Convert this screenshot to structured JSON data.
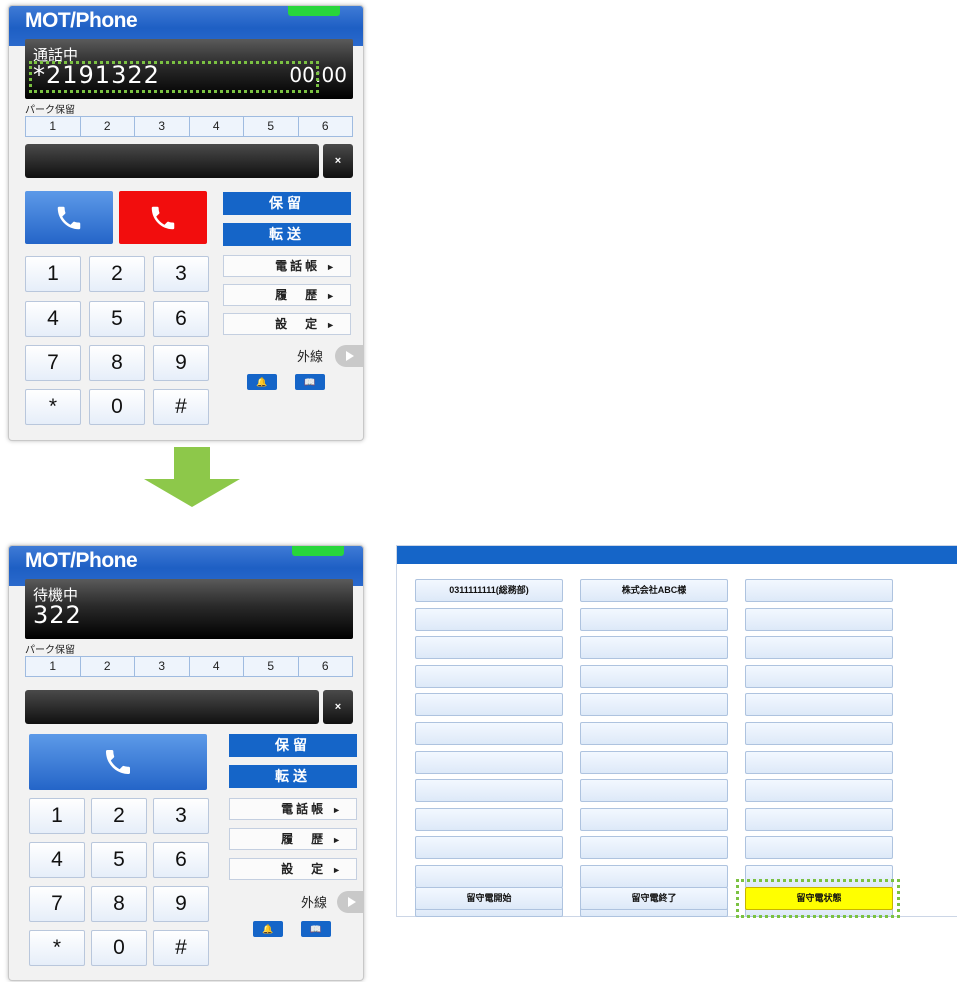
{
  "phone_top": {
    "logo": "MOT/Phone",
    "status": "通話中",
    "number": "*2191322",
    "timer": "00:00",
    "park_label": "パーク保留",
    "park_slots": [
      "1",
      "2",
      "3",
      "4",
      "5",
      "6"
    ],
    "clear_label": "×",
    "hold_label": "保留",
    "transfer_label": "転送",
    "menu": [
      "電話帳",
      "履　歴",
      "設　定"
    ],
    "menu_arrow": "►",
    "keys": [
      "1",
      "2",
      "3",
      "4",
      "5",
      "6",
      "7",
      "8",
      "9",
      "*",
      "0",
      "#"
    ],
    "outside_line_label": "外線"
  },
  "phone_bottom": {
    "logo": "MOT/Phone",
    "status": "待機中",
    "number": "322",
    "park_label": "パーク保留",
    "park_slots": [
      "1",
      "2",
      "3",
      "4",
      "5",
      "6"
    ],
    "clear_label": "×",
    "hold_label": "保留",
    "transfer_label": "転送",
    "menu": [
      "電話帳",
      "履　歴",
      "設　定"
    ],
    "menu_arrow": "►",
    "keys": [
      "1",
      "2",
      "3",
      "4",
      "5",
      "6",
      "7",
      "8",
      "9",
      "*",
      "0",
      "#"
    ],
    "outside_line_label": "外線"
  },
  "speed_dial": {
    "columns": [
      [
        "0311111111(総務部)",
        "",
        "",
        "",
        "",
        "",
        "",
        "",
        "",
        "",
        "",
        ""
      ],
      [
        "株式会社ABC様",
        "",
        "",
        "",
        "",
        "",
        "",
        "",
        "",
        "",
        "",
        ""
      ],
      [
        "",
        "",
        "",
        "",
        "",
        "",
        "",
        "",
        "",
        "",
        "",
        ""
      ]
    ],
    "bottom_buttons": [
      "留守電開始",
      "留守電終了",
      "留守電状態"
    ]
  },
  "colors": {
    "accent_blue": "#1565c8",
    "call_red": "#f20d0d",
    "highlight_yellow": "#ffff00",
    "highlight_green": "#7bc242",
    "led_green": "#28d63c"
  }
}
